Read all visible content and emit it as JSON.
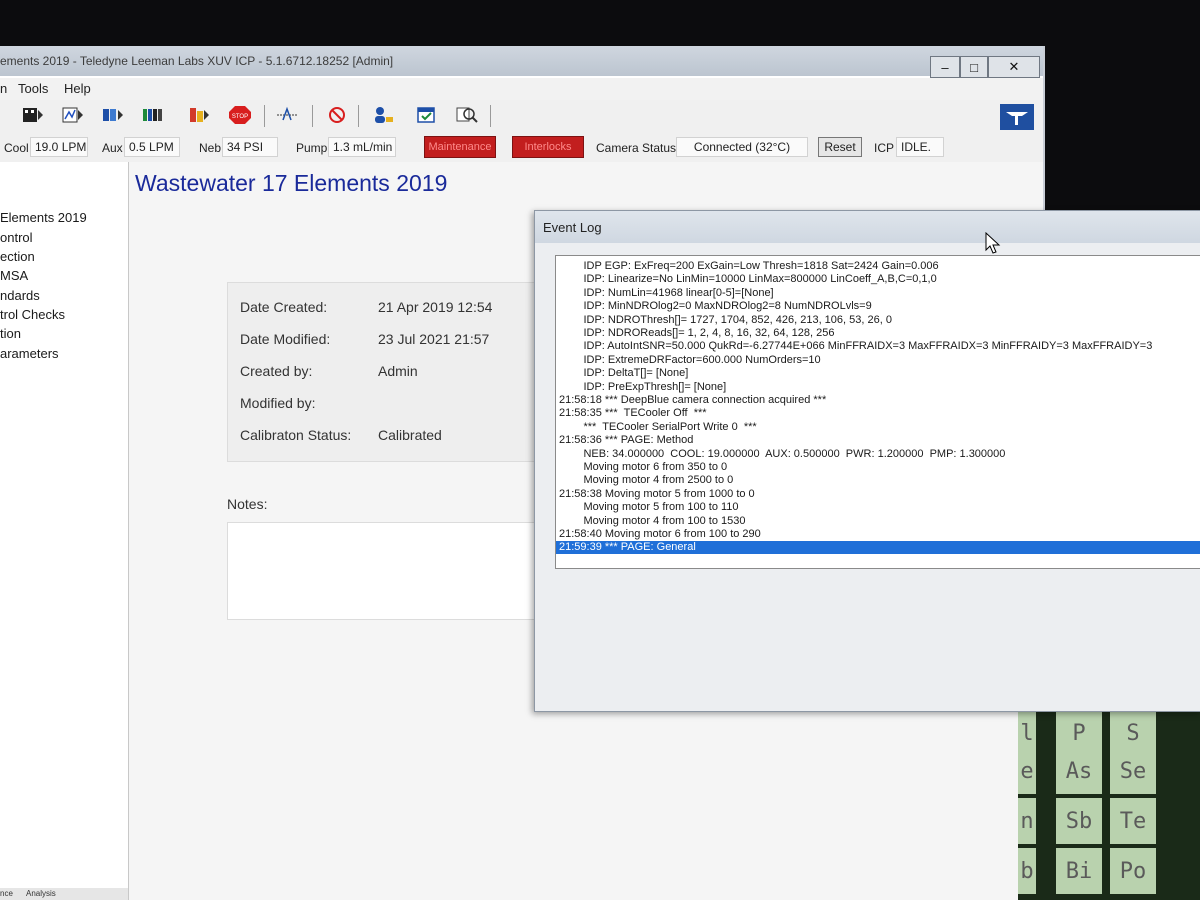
{
  "window": {
    "title": "ements 2019 - Teledyne Leeman Labs XUV ICP - 5.1.6712.18252  [Admin]",
    "controls": {
      "minimize": "–",
      "maximize": "□",
      "close": "✕"
    }
  },
  "menu": {
    "items": [
      "n",
      "Tools",
      "Help"
    ]
  },
  "toolbar": {
    "icons": [
      "film-icon",
      "chart-icon",
      "run-icon",
      "multi-run-icon",
      "flask-icon",
      "stop-icon",
      "peak-icon",
      "no-icon",
      "user-icon",
      "check-icon",
      "search-icon"
    ],
    "stop_label": "STOP"
  },
  "status": {
    "cool_label": "Cool",
    "cool_value": "19.0 LPM",
    "aux_label": "Aux",
    "aux_value": "0.5 LPM",
    "neb_label": "Neb",
    "neb_value": "34 PSI",
    "pump_label": "Pump",
    "pump_value": "1.3 mL/min",
    "maintenance": "Maintenance",
    "interlocks": "Interlocks",
    "camera_label": "Camera Status:",
    "camera_value": "Connected (32°C)",
    "reset": "Reset",
    "icp_label": "ICP",
    "icp_value": "IDLE."
  },
  "sidebar": {
    "items": [
      "Elements 2019",
      "ontrol",
      "ection",
      "MSA",
      "ndards",
      "trol Checks",
      "tion",
      "arameters"
    ]
  },
  "method": {
    "title": "Wastewater 17 Elements 2019",
    "fields": [
      {
        "label": "Date Created:",
        "value": "21 Apr 2019  12:54"
      },
      {
        "label": "Date Modified:",
        "value": "23 Jul 2021  21:57"
      },
      {
        "label": "Created by:",
        "value": "Admin"
      },
      {
        "label": "Modified by:",
        "value": ""
      },
      {
        "label": "Calibraton Status:",
        "value": "Calibrated"
      }
    ],
    "notes_label": "Notes:"
  },
  "bottom_tabs": [
    "nce",
    "Analysis"
  ],
  "periodic_tiles": [
    "l",
    "P",
    "S",
    "e",
    "As",
    "Se",
    "n",
    "Sb",
    "Te",
    "b",
    "Bi",
    "Po"
  ],
  "event_log": {
    "title": "Event Log",
    "lines": [
      "        IDP EGP: ExFreq=200 ExGain=Low Thresh=1818 Sat=2424 Gain=0.006",
      "        IDP: Linearize=No LinMin=10000 LinMax=800000 LinCoeff_A,B,C=0,1,0",
      "        IDP: NumLin=41968 linear[0-5]=[None]",
      "        IDP: MinNDROlog2=0 MaxNDROlog2=8 NumNDROLvls=9",
      "        IDP: NDROThresh[]= 1727, 1704, 852, 426, 213, 106, 53, 26, 0",
      "        IDP: NDROReads[]= 1, 2, 4, 8, 16, 32, 64, 128, 256",
      "        IDP: AutoIntSNR=50.000 QukRd=-6.27744E+066 MinFFRAIDX=3 MaxFFRAIDX=3 MinFFRAIDY=3 MaxFFRAIDY=3",
      "        IDP: ExtremeDRFactor=600.000 NumOrders=10",
      "        IDP: DeltaT[]= [None]",
      "        IDP: PreExpThresh[]= [None]",
      "21:58:18 *** DeepBlue camera connection acquired ***",
      "21:58:35 ***  TECooler Off  ***",
      "        ***  TECooler SerialPort Write 0  ***",
      "21:58:36 *** PAGE: Method",
      "        NEB: 34.000000  COOL: 19.000000  AUX: 0.500000  PWR: 1.200000  PMP: 1.300000",
      "        Moving motor 6 from 350 to 0",
      "        Moving motor 4 from 2500 to 0",
      "21:58:38 Moving motor 5 from 1000 to 0",
      "        Moving motor 5 from 100 to 110",
      "        Moving motor 4 from 100 to 1530",
      "21:58:40 Moving motor 6 from 100 to 290",
      "21:59:39 *** PAGE: General"
    ],
    "selected_index": 21
  },
  "colors": {
    "heading": "#1a2a9a",
    "selection": "#1f6fd8",
    "alarm_red": "#c21e1e"
  }
}
